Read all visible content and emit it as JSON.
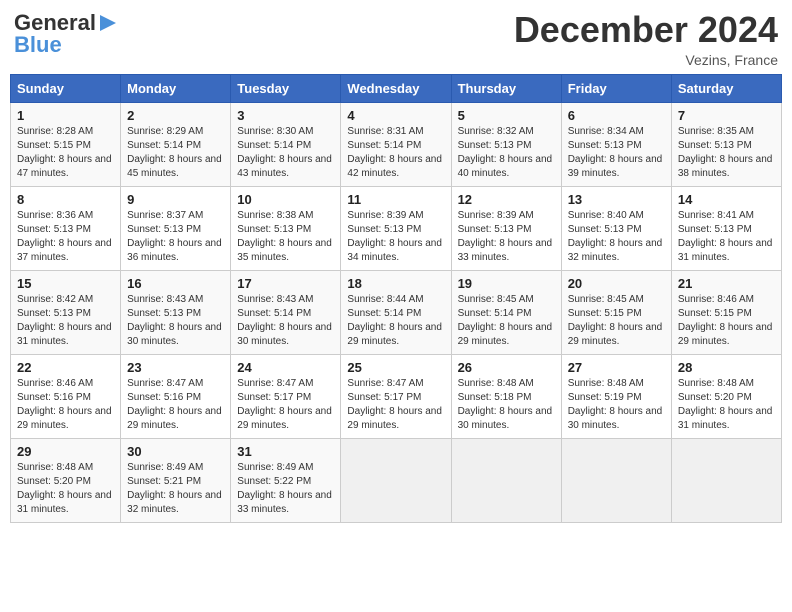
{
  "header": {
    "logo_general": "General",
    "logo_blue": "Blue",
    "month": "December 2024",
    "location": "Vezins, France"
  },
  "days_of_week": [
    "Sunday",
    "Monday",
    "Tuesday",
    "Wednesday",
    "Thursday",
    "Friday",
    "Saturday"
  ],
  "weeks": [
    [
      {
        "day": 1,
        "sunrise": "8:28 AM",
        "sunset": "5:15 PM",
        "daylight": "8 hours and 47 minutes."
      },
      {
        "day": 2,
        "sunrise": "8:29 AM",
        "sunset": "5:14 PM",
        "daylight": "8 hours and 45 minutes."
      },
      {
        "day": 3,
        "sunrise": "8:30 AM",
        "sunset": "5:14 PM",
        "daylight": "8 hours and 43 minutes."
      },
      {
        "day": 4,
        "sunrise": "8:31 AM",
        "sunset": "5:14 PM",
        "daylight": "8 hours and 42 minutes."
      },
      {
        "day": 5,
        "sunrise": "8:32 AM",
        "sunset": "5:13 PM",
        "daylight": "8 hours and 40 minutes."
      },
      {
        "day": 6,
        "sunrise": "8:34 AM",
        "sunset": "5:13 PM",
        "daylight": "8 hours and 39 minutes."
      },
      {
        "day": 7,
        "sunrise": "8:35 AM",
        "sunset": "5:13 PM",
        "daylight": "8 hours and 38 minutes."
      }
    ],
    [
      {
        "day": 8,
        "sunrise": "8:36 AM",
        "sunset": "5:13 PM",
        "daylight": "8 hours and 37 minutes."
      },
      {
        "day": 9,
        "sunrise": "8:37 AM",
        "sunset": "5:13 PM",
        "daylight": "8 hours and 36 minutes."
      },
      {
        "day": 10,
        "sunrise": "8:38 AM",
        "sunset": "5:13 PM",
        "daylight": "8 hours and 35 minutes."
      },
      {
        "day": 11,
        "sunrise": "8:39 AM",
        "sunset": "5:13 PM",
        "daylight": "8 hours and 34 minutes."
      },
      {
        "day": 12,
        "sunrise": "8:39 AM",
        "sunset": "5:13 PM",
        "daylight": "8 hours and 33 minutes."
      },
      {
        "day": 13,
        "sunrise": "8:40 AM",
        "sunset": "5:13 PM",
        "daylight": "8 hours and 32 minutes."
      },
      {
        "day": 14,
        "sunrise": "8:41 AM",
        "sunset": "5:13 PM",
        "daylight": "8 hours and 31 minutes."
      }
    ],
    [
      {
        "day": 15,
        "sunrise": "8:42 AM",
        "sunset": "5:13 PM",
        "daylight": "8 hours and 31 minutes."
      },
      {
        "day": 16,
        "sunrise": "8:43 AM",
        "sunset": "5:13 PM",
        "daylight": "8 hours and 30 minutes."
      },
      {
        "day": 17,
        "sunrise": "8:43 AM",
        "sunset": "5:14 PM",
        "daylight": "8 hours and 30 minutes."
      },
      {
        "day": 18,
        "sunrise": "8:44 AM",
        "sunset": "5:14 PM",
        "daylight": "8 hours and 29 minutes."
      },
      {
        "day": 19,
        "sunrise": "8:45 AM",
        "sunset": "5:14 PM",
        "daylight": "8 hours and 29 minutes."
      },
      {
        "day": 20,
        "sunrise": "8:45 AM",
        "sunset": "5:15 PM",
        "daylight": "8 hours and 29 minutes."
      },
      {
        "day": 21,
        "sunrise": "8:46 AM",
        "sunset": "5:15 PM",
        "daylight": "8 hours and 29 minutes."
      }
    ],
    [
      {
        "day": 22,
        "sunrise": "8:46 AM",
        "sunset": "5:16 PM",
        "daylight": "8 hours and 29 minutes."
      },
      {
        "day": 23,
        "sunrise": "8:47 AM",
        "sunset": "5:16 PM",
        "daylight": "8 hours and 29 minutes."
      },
      {
        "day": 24,
        "sunrise": "8:47 AM",
        "sunset": "5:17 PM",
        "daylight": "8 hours and 29 minutes."
      },
      {
        "day": 25,
        "sunrise": "8:47 AM",
        "sunset": "5:17 PM",
        "daylight": "8 hours and 29 minutes."
      },
      {
        "day": 26,
        "sunrise": "8:48 AM",
        "sunset": "5:18 PM",
        "daylight": "8 hours and 30 minutes."
      },
      {
        "day": 27,
        "sunrise": "8:48 AM",
        "sunset": "5:19 PM",
        "daylight": "8 hours and 30 minutes."
      },
      {
        "day": 28,
        "sunrise": "8:48 AM",
        "sunset": "5:20 PM",
        "daylight": "8 hours and 31 minutes."
      }
    ],
    [
      {
        "day": 29,
        "sunrise": "8:48 AM",
        "sunset": "5:20 PM",
        "daylight": "8 hours and 31 minutes."
      },
      {
        "day": 30,
        "sunrise": "8:49 AM",
        "sunset": "5:21 PM",
        "daylight": "8 hours and 32 minutes."
      },
      {
        "day": 31,
        "sunrise": "8:49 AM",
        "sunset": "5:22 PM",
        "daylight": "8 hours and 33 minutes."
      },
      null,
      null,
      null,
      null
    ]
  ]
}
